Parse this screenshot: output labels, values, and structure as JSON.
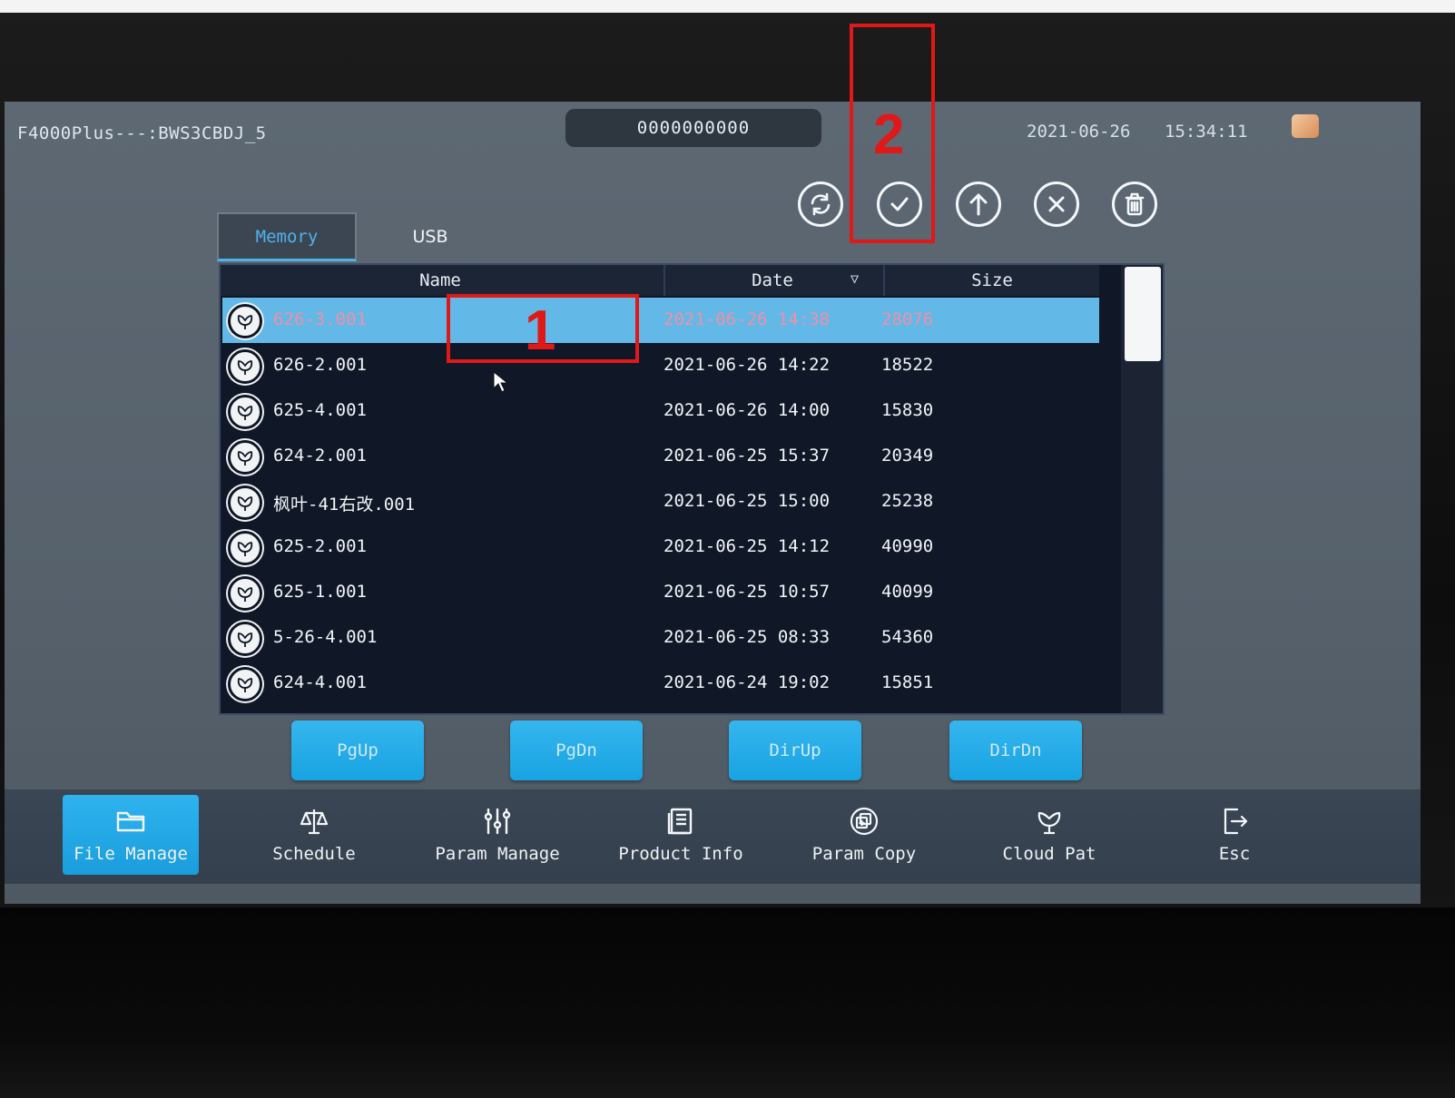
{
  "header": {
    "device_title": "F4000Plus---:BWS3CBDJ_5",
    "counter": "0000000000",
    "date": "2021-06-26",
    "time": "15:34:11"
  },
  "toolbar": {
    "refresh_icon": "refresh-icon",
    "confirm_icon": "check-circle-icon",
    "upload_icon": "arrow-up-circle-icon",
    "cancel_icon": "x-circle-icon",
    "delete_icon": "trash-icon"
  },
  "tabs": [
    {
      "label": "Memory",
      "active": true
    },
    {
      "label": "USB",
      "active": false
    }
  ],
  "table": {
    "columns": [
      "Name",
      "Date",
      "Size"
    ],
    "rows": [
      {
        "name": "626-3.001",
        "date": "2021-06-26 14:38",
        "size": "28076",
        "selected": true
      },
      {
        "name": "626-2.001",
        "date": "2021-06-26 14:22",
        "size": "18522"
      },
      {
        "name": "625-4.001",
        "date": "2021-06-26 14:00",
        "size": "15830"
      },
      {
        "name": "624-2.001",
        "date": "2021-06-25 15:37",
        "size": "20349"
      },
      {
        "name": "枫叶-41右改.001",
        "date": "2021-06-25 15:00",
        "size": "25238"
      },
      {
        "name": "625-2.001",
        "date": "2021-06-25 14:12",
        "size": "40990"
      },
      {
        "name": "625-1.001",
        "date": "2021-06-25 10:57",
        "size": "40099"
      },
      {
        "name": "5-26-4.001",
        "date": "2021-06-25 08:33",
        "size": "54360"
      },
      {
        "name": "624-4.001",
        "date": "2021-06-24 19:02",
        "size": "15851"
      }
    ]
  },
  "page_nav": {
    "pgup": "PgUp",
    "pgdn": "PgDn",
    "dirup": "DirUp",
    "dirdn": "DirDn"
  },
  "bottom_nav": [
    {
      "label": "File Manage",
      "icon": "folder-icon",
      "active": true
    },
    {
      "label": "Schedule",
      "icon": "scale-icon"
    },
    {
      "label": "Param Manage",
      "icon": "sliders-icon"
    },
    {
      "label": "Product Info",
      "icon": "document-icon"
    },
    {
      "label": "Param Copy",
      "icon": "copy-circle-icon"
    },
    {
      "label": "Cloud Pat",
      "icon": "flower-icon"
    },
    {
      "label": "Esc",
      "icon": "exit-icon"
    }
  ],
  "annotations": {
    "label_1": "1",
    "label_2": "2"
  },
  "colors": {
    "accent": "#1ea6e6",
    "selected_row": "#62b8e6",
    "annotation": "#e01818"
  }
}
